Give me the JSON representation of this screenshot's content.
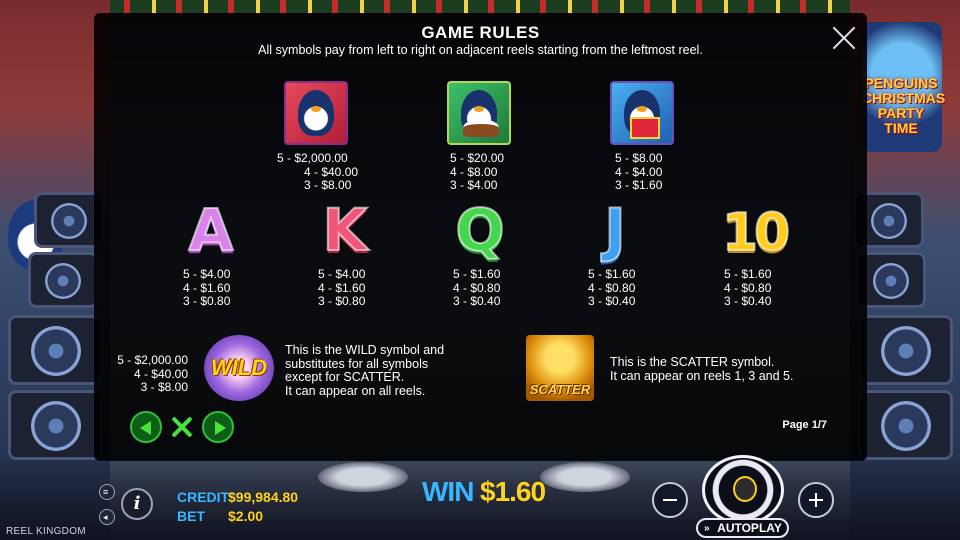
{
  "modal": {
    "title": "GAME RULES",
    "subtitle": "All symbols pay from left to right on adjacent reels starting from the leftmost reel.",
    "page_indicator": "Page 1/7"
  },
  "premium_symbols": [
    {
      "name": "penguin-guitar",
      "pays": [
        "5 - $2,000.00",
        "4 - $40.00",
        "3 - $8.00"
      ]
    },
    {
      "name": "penguin-cake",
      "pays": [
        "5 - $20.00",
        "4 - $8.00",
        "3 - $4.00"
      ]
    },
    {
      "name": "penguin-gift",
      "pays": [
        "5 - $8.00",
        "4 - $4.00",
        "3 - $1.60"
      ]
    }
  ],
  "low_symbols": [
    {
      "glyph": "A",
      "pays": [
        "5 - $4.00",
        "4 - $1.60",
        "3 - $0.80"
      ]
    },
    {
      "glyph": "K",
      "pays": [
        "5 - $4.00",
        "4 - $1.60",
        "3 - $0.80"
      ]
    },
    {
      "glyph": "Q",
      "pays": [
        "5 - $1.60",
        "4 - $0.80",
        "3 - $0.40"
      ]
    },
    {
      "glyph": "J",
      "pays": [
        "5 - $1.60",
        "4 - $0.80",
        "3 - $0.40"
      ]
    },
    {
      "glyph": "10",
      "pays": [
        "5 - $1.60",
        "4 - $0.80",
        "3 - $0.40"
      ]
    }
  ],
  "wild": {
    "icon_text": "WILD",
    "pays": [
      "5 - $2,000.00",
      "4 - $40.00",
      "3 - $8.00"
    ],
    "description": [
      "This is the WILD symbol and",
      "substitutes for all symbols",
      "except for SCATTER.",
      "It can appear on all reels."
    ]
  },
  "scatter": {
    "icon_text": "SCATTER",
    "description": [
      "This is the SCATTER symbol.",
      "It can appear on reels 1, 3 and 5."
    ]
  },
  "background": {
    "logo_text": "PENGUINS CHRISTMAS PARTY TIME"
  },
  "bottom_bar": {
    "credit_label": "CREDIT",
    "credit_value": "$99,984.80",
    "bet_label": "BET",
    "bet_value": "$2.00",
    "win_label": "WIN",
    "win_value": "$1.60",
    "autoplay_label": "AUTOPLAY",
    "info_label": "i",
    "brand": "REEL KINGDOM"
  },
  "colors": {
    "label_blue": "#38b6ff",
    "value_gold": "#ffd21c",
    "nav_green": "#49e23f"
  }
}
